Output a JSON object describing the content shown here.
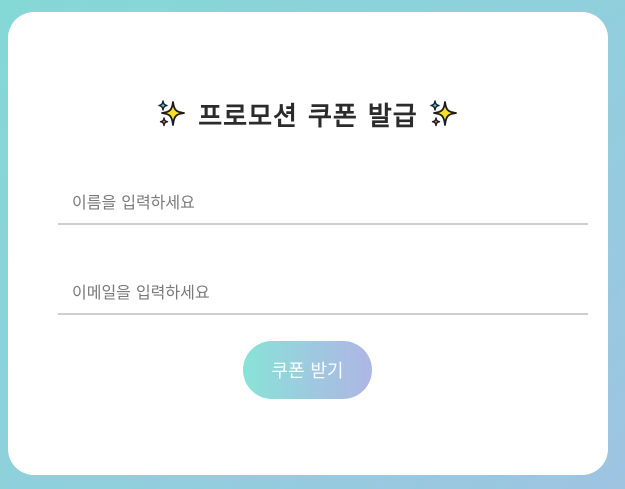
{
  "form": {
    "title": "프로모션 쿠폰 발급",
    "title_icon": "sparkles-icon",
    "name_placeholder": "이름을 입력하세요",
    "email_placeholder": "이메일을 입력하세요",
    "name_value": "",
    "email_value": "",
    "submit_label": "쿠폰 받기"
  },
  "colors": {
    "background_start": "#84d8d6",
    "background_end": "#9ec4e2",
    "card": "#ffffff",
    "title": "#2b2b2b",
    "button_start": "#88e3d7",
    "button_end": "#aeb6e4"
  }
}
